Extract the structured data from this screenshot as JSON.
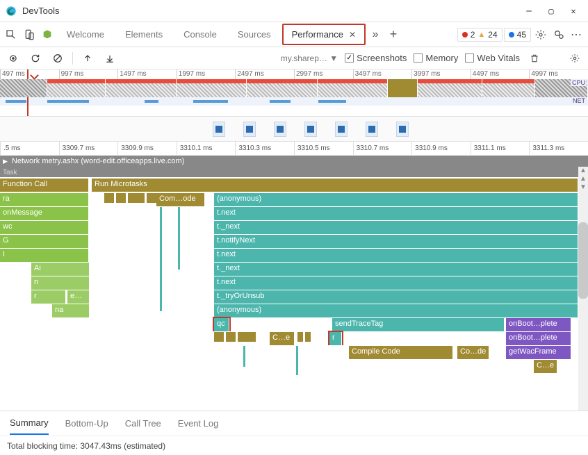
{
  "window": {
    "title": "DevTools"
  },
  "tabs": {
    "list": [
      "Welcome",
      "Elements",
      "Console",
      "Sources",
      "Performance"
    ],
    "active": "Performance"
  },
  "badges": {
    "errors": "2",
    "warnings": "24",
    "info": "45"
  },
  "toolbar": {
    "target": "my.sharep…",
    "screenshots_label": "Screenshots",
    "screenshots_checked": true,
    "memory_label": "Memory",
    "memory_checked": false,
    "webvitals_label": "Web Vitals",
    "webvitals_checked": false
  },
  "overview_ticks": [
    "497 ms",
    "997 ms",
    "1497 ms",
    "1997 ms",
    "2497 ms",
    "2997 ms",
    "3497 ms",
    "3997 ms",
    "4497 ms",
    "4997 ms"
  ],
  "detail_ticks": [
    ".5 ms",
    "3309.7 ms",
    "3309.9 ms",
    "3310.1 ms",
    "3310.3 ms",
    "3310.5 ms",
    "3310.7 ms",
    "3310.9 ms",
    "3311.1 ms",
    "3311.3 ms"
  ],
  "network_strip": "Network  metry.ashx (word-edit.officeapps.live.com)",
  "task_label": "Task",
  "flame": {
    "function_call": "Function Call",
    "run_microtasks": "Run Microtasks",
    "left_stack": [
      "ra",
      "onMessage",
      "wc",
      "G",
      "I"
    ],
    "left_sub": [
      "Ai",
      "n",
      "r",
      "e…",
      "na"
    ],
    "compile": "Com…ode",
    "teal_stack": [
      "(anonymous)",
      "t.next",
      "t._next",
      "t.notifyNext",
      "t.next",
      "t._next",
      "t.next",
      "t._tryOrUnsub",
      "(anonymous)"
    ],
    "qc": "qc",
    "sendTraceTag": "sendTraceTag",
    "r": "r",
    "compile_code": "Compile Code",
    "co_de": "Co…de",
    "c_de": "C…e",
    "onboot": "onBoot…plete",
    "getwac": "getWacFrame",
    "ce2": "C…e"
  },
  "bottom_tabs": [
    "Summary",
    "Bottom-Up",
    "Call Tree",
    "Event Log"
  ],
  "footer": "Total blocking time: 3047.43ms (estimated)",
  "chart_data": {
    "type": "flame",
    "time_window_ms": [
      3309.5,
      3311.4
    ],
    "overview_window_ms": [
      497,
      5000
    ],
    "total_blocking_time_ms": 3047.43,
    "network": [
      {
        "url_fragment": "metry.ashx",
        "host": "word-edit.officeapps.live.com"
      }
    ],
    "threads": {
      "left_stack": [
        {
          "name": "Function Call",
          "category": "scripting"
        },
        {
          "name": "ra",
          "category": "scripting-green"
        },
        {
          "name": "onMessage",
          "category": "scripting-green"
        },
        {
          "name": "wc",
          "category": "scripting-green"
        },
        {
          "name": "G",
          "category": "scripting-green"
        },
        {
          "name": "I",
          "category": "scripting-green"
        },
        {
          "name": "Ai",
          "category": "scripting-green"
        },
        {
          "name": "n",
          "category": "scripting-green"
        },
        {
          "name": "r",
          "category": "scripting-green"
        },
        {
          "name": "e…",
          "category": "scripting-green"
        },
        {
          "name": "na",
          "category": "scripting-green"
        }
      ],
      "right_stack": [
        {
          "name": "Run Microtasks",
          "category": "scripting"
        },
        {
          "name": "Com…ode",
          "category": "scripting"
        },
        {
          "name": "(anonymous)",
          "category": "scripting-teal"
        },
        {
          "name": "t.next",
          "category": "scripting-teal"
        },
        {
          "name": "t._next",
          "category": "scripting-teal"
        },
        {
          "name": "t.notifyNext",
          "category": "scripting-teal"
        },
        {
          "name": "t.next",
          "category": "scripting-teal"
        },
        {
          "name": "t._next",
          "category": "scripting-teal"
        },
        {
          "name": "t.next",
          "category": "scripting-teal"
        },
        {
          "name": "t._tryOrUnsub",
          "category": "scripting-teal"
        },
        {
          "name": "(anonymous)",
          "category": "scripting-teal"
        },
        {
          "name": "qc",
          "category": "scripting-teal",
          "highlighted": true
        },
        {
          "name": "sendTraceTag",
          "category": "scripting-teal"
        },
        {
          "name": "r",
          "category": "scripting-teal",
          "highlighted": true
        },
        {
          "name": "Compile Code",
          "category": "scripting"
        },
        {
          "name": "Co…de",
          "category": "scripting"
        },
        {
          "name": "C…e",
          "category": "scripting"
        },
        {
          "name": "onBoot…plete",
          "category": "scripting-purple"
        },
        {
          "name": "onBoot…plete",
          "category": "scripting-purple"
        },
        {
          "name": "getWacFrame",
          "category": "scripting-purple"
        },
        {
          "name": "C…e",
          "category": "scripting"
        }
      ]
    }
  }
}
